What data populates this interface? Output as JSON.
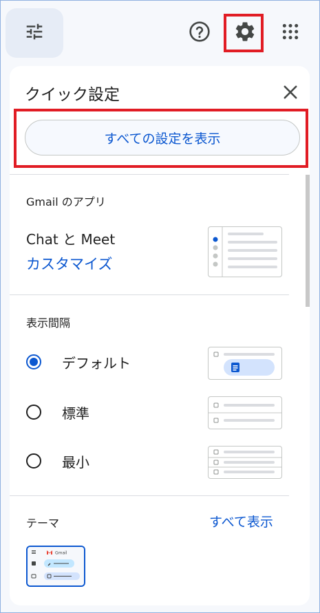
{
  "toolbar": {
    "filter_icon": "tune-icon",
    "help_icon": "help-icon",
    "settings_icon": "gear-icon",
    "apps_icon": "apps-grid-icon"
  },
  "quick_settings": {
    "title": "クイック設定",
    "close_icon": "close-icon",
    "see_all_button": "すべての設定を表示",
    "apps_section": {
      "title": "Gmail のアプリ",
      "item_title": "Chat と Meet",
      "customize_link": "カスタマイズ"
    },
    "density_section": {
      "title": "表示間隔",
      "options": [
        {
          "label": "デフォルト",
          "selected": true
        },
        {
          "label": "標準",
          "selected": false
        },
        {
          "label": "最小",
          "selected": false
        }
      ]
    },
    "theme_section": {
      "title": "テーマ",
      "see_all_link": "すべて表示",
      "thumb_logo_text": "Gmail"
    }
  },
  "colors": {
    "accent": "#0b57d0",
    "highlight": "#e11c24",
    "background": "#f6f8fc"
  }
}
